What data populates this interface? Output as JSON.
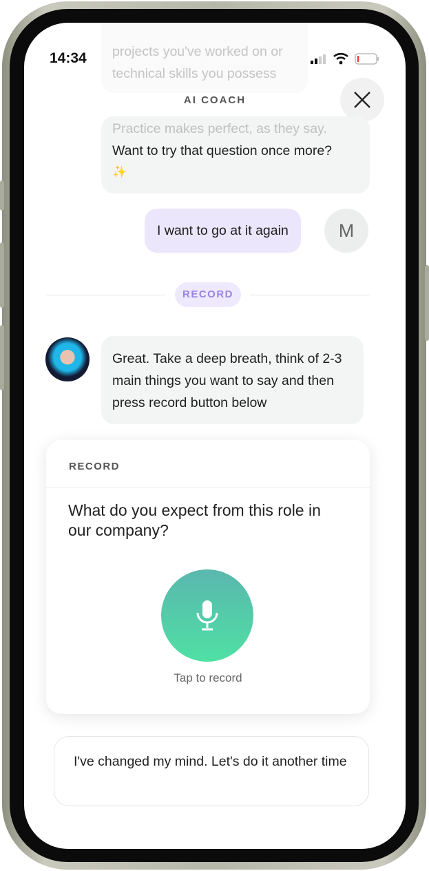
{
  "status_bar": {
    "time": "14:34",
    "battery_level": "low"
  },
  "header": {
    "title": "AI COACH"
  },
  "messages": [
    {
      "from": "coach",
      "text_faded": "projects you've worked on or technical skills you possess"
    },
    {
      "from": "coach",
      "text_faded": "Practice makes perfect, as they say.",
      "text": "Want to try that question once more?",
      "emoji": "✨"
    },
    {
      "from": "user",
      "text": "I want to go at it again",
      "avatar_initial": "M"
    }
  ],
  "divider": {
    "label": "RECORD"
  },
  "coach_message": {
    "text": "Great. Take a deep breath, think of 2-3 main things you want to say and then press record button below"
  },
  "record_card": {
    "header": "RECORD",
    "question": "What do you expect from this role in our company?",
    "mic_label": "Tap to record"
  },
  "alt_reply": {
    "text": "I've changed my mind. Let's do it another time"
  },
  "colors": {
    "accent": "#9a84e0",
    "user_bubble": "#ebe6fb",
    "mic_top": "#5ab7ae",
    "mic_bottom": "#4fe0a4"
  }
}
